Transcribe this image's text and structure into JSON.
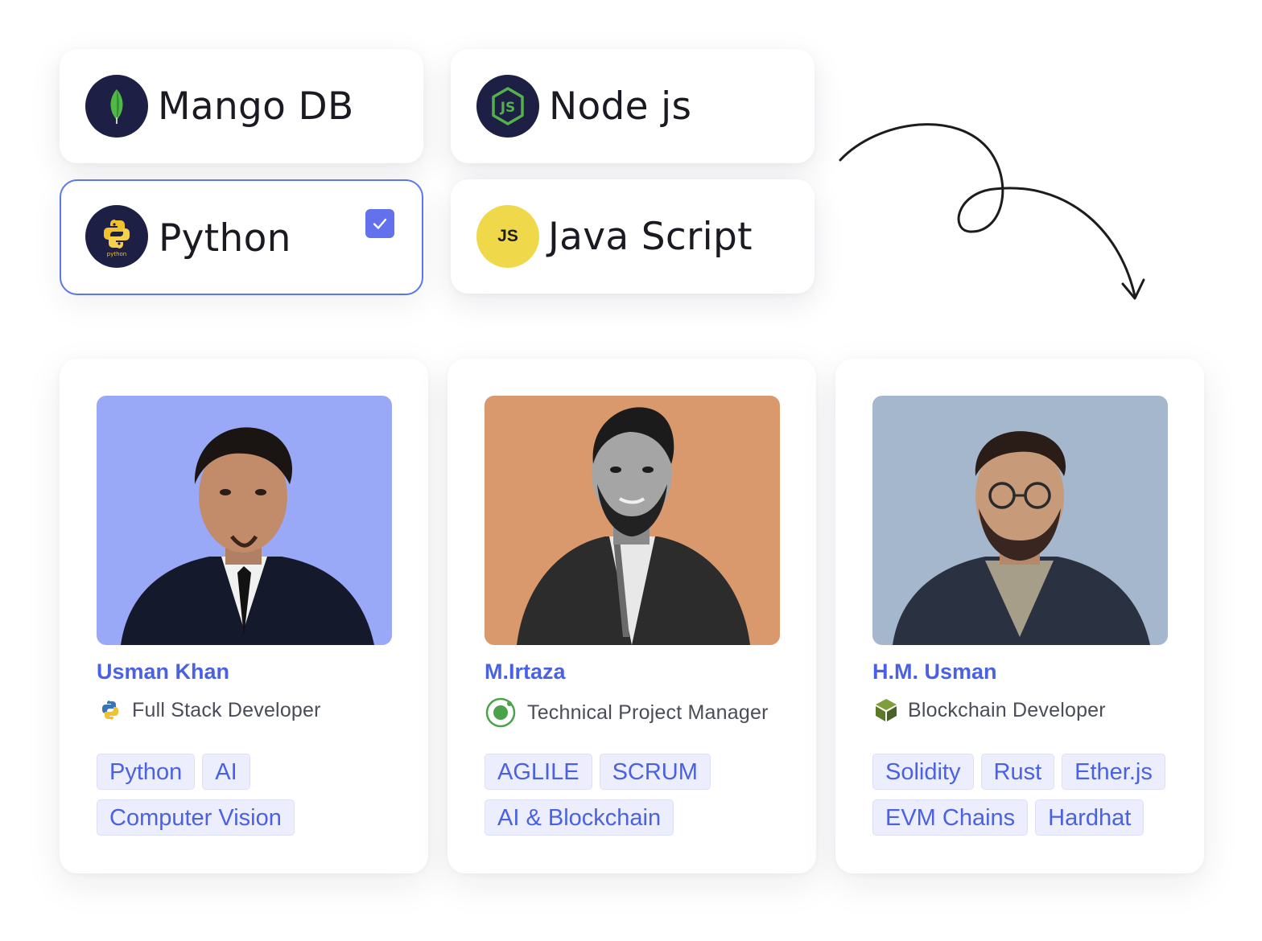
{
  "tech_options": [
    {
      "label": "Mango DB",
      "icon": "mongodb-leaf-icon",
      "selected": false
    },
    {
      "label": "Node js",
      "icon": "nodejs-icon",
      "selected": false
    },
    {
      "label": "Python",
      "icon": "python-icon",
      "selected": true
    },
    {
      "label": "Java Script",
      "icon": "javascript-icon",
      "selected": false,
      "icon_text": "JS"
    }
  ],
  "colors": {
    "accent": "#4a62e2",
    "checkbox": "#6371ec",
    "selected_border": "#5a78e6",
    "tag_bg": "#eceefd",
    "logo_bg": "#1d1f45",
    "js_logo_bg": "#efd94a"
  },
  "developers": [
    {
      "name": "Usman Khan",
      "role": "Full Stack Developer",
      "role_icon": "python-icon",
      "photo_bg": "#9aa8f8",
      "tags": [
        [
          "Python",
          "AI"
        ],
        [
          "Computer Vision"
        ]
      ]
    },
    {
      "name": "M.Irtaza",
      "role": "Technical Project Manager",
      "role_icon": "ionic-ring-icon",
      "photo_bg": "#d9996c",
      "tags": [
        [
          "AGLILE",
          "SCRUM"
        ],
        [
          "AI & Blockchain"
        ]
      ]
    },
    {
      "name": "H.M. Usman",
      "role": "Blockchain Developer",
      "role_icon": "blockchain-cube-icon",
      "photo_bg": "#a4b7cc",
      "tags": [
        [
          "Solidity",
          "Rust",
          "Ether.js"
        ],
        [
          "EVM Chains",
          "Hardhat"
        ]
      ]
    }
  ]
}
